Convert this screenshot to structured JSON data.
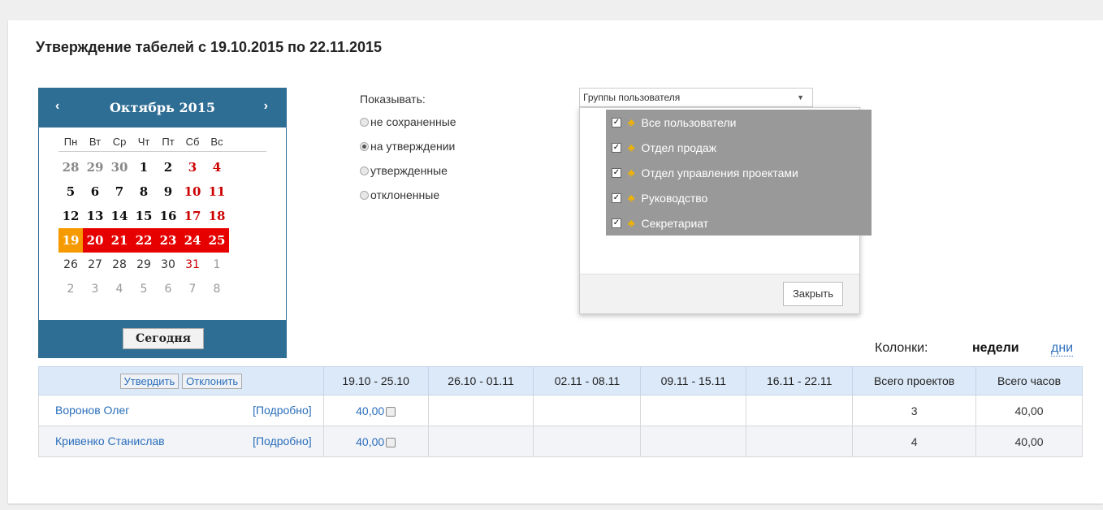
{
  "title": "Утверждение табелей с 19.10.2015 по 22.11.2015",
  "calendar": {
    "prev": "‹",
    "next": "›",
    "month": "Октябрь 2015",
    "dow": [
      "Пн",
      "Вт",
      "Ср",
      "Чт",
      "Пт",
      "Сб",
      "Вс"
    ],
    "weeks": [
      [
        "28",
        "29",
        "30",
        "1",
        "2",
        "3",
        "4"
      ],
      [
        "5",
        "6",
        "7",
        "8",
        "9",
        "10",
        "11"
      ],
      [
        "12",
        "13",
        "14",
        "15",
        "16",
        "17",
        "18"
      ],
      [
        "19",
        "20",
        "21",
        "22",
        "23",
        "24",
        "25"
      ],
      [
        "26",
        "27",
        "28",
        "29",
        "30",
        "31",
        "1"
      ],
      [
        "2",
        "3",
        "4",
        "5",
        "6",
        "7",
        "8"
      ]
    ],
    "today_label": "Сегодня",
    "colors": {
      "header": "#2e6d94",
      "selected": "#e60000",
      "today": "#f59a00"
    }
  },
  "show": {
    "label": "Показывать:",
    "options": [
      "не сохраненные",
      "на утверждении",
      "утвержденные",
      "отклоненные"
    ],
    "selected": "на утверждении"
  },
  "groups": {
    "select_label": "Группы пользователя",
    "items": [
      "Все пользователи",
      "Отдел продаж",
      "Отдел управления проектами",
      "Руководство",
      "Секретариат"
    ],
    "close_label": "Закрыть"
  },
  "columns": {
    "label": "Колонки:",
    "weeks": "недели",
    "days": "дни"
  },
  "table": {
    "approve": "Утвердить",
    "reject": "Отклонить",
    "headers": [
      "19.10 - 25.10",
      "26.10 - 01.11",
      "02.11 - 08.11",
      "09.11 - 15.11",
      "16.11 - 22.11",
      "Всего проектов",
      "Всего часов"
    ],
    "rows": [
      {
        "name": "Воронов Олег",
        "more": "[Подробно]",
        "week1": "40,00",
        "projects": "3",
        "hours": "40,00"
      },
      {
        "name": "Кривенко Станислав",
        "more": "[Подробно]",
        "week1": "40,00",
        "projects": "4",
        "hours": "40,00"
      }
    ]
  }
}
